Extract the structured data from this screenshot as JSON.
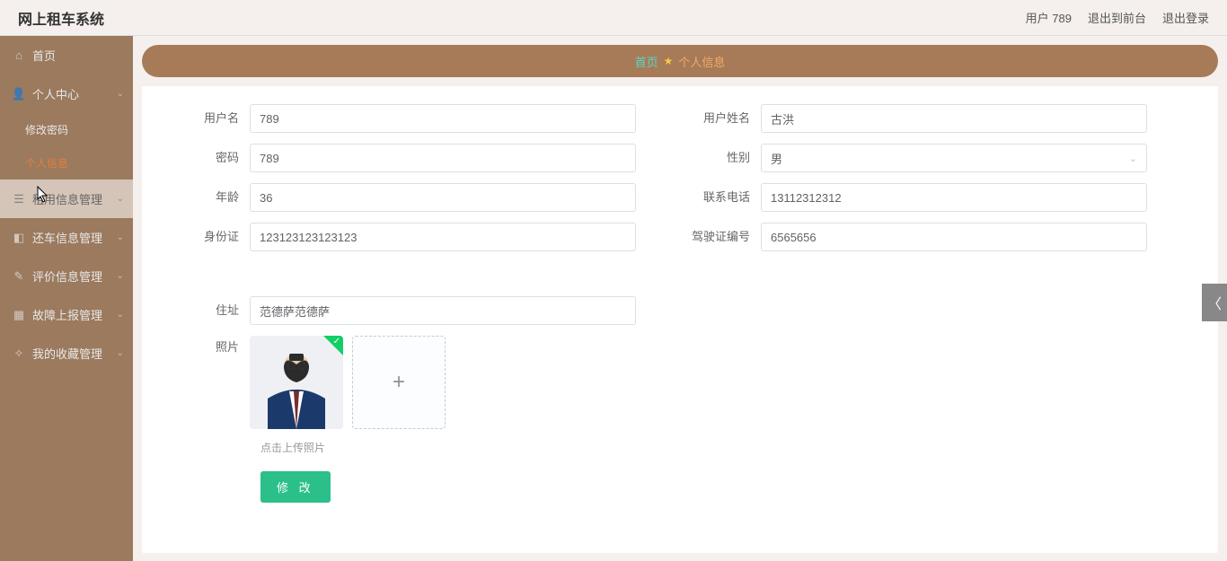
{
  "header": {
    "app_title": "网上租车系统",
    "user_label": "用户 789",
    "exit_front": "退出到前台",
    "logout": "退出登录"
  },
  "sidebar": {
    "home": "首页",
    "personal_center": "个人中心",
    "change_password": "修改密码",
    "personal_info": "个人信息",
    "rent_mgmt": "租用信息管理",
    "return_mgmt": "还车信息管理",
    "review_mgmt": "评价信息管理",
    "fault_mgmt": "故障上报管理",
    "favorite_mgmt": "我的收藏管理"
  },
  "breadcrumb": {
    "home": "首页",
    "current": "个人信息"
  },
  "form": {
    "username_label": "用户名",
    "username_value": "789",
    "realname_label": "用户姓名",
    "realname_value": "古洪",
    "password_label": "密码",
    "password_value": "789",
    "gender_label": "性别",
    "gender_value": "男",
    "age_label": "年龄",
    "age_value": "36",
    "phone_label": "联系电话",
    "phone_value": "13112312312",
    "idcard_label": "身份证",
    "idcard_value": "123123123123123",
    "license_label": "驾驶证编号",
    "license_value": "6565656",
    "address_label": "住址",
    "address_value": "范德萨范德萨",
    "photo_label": "照片",
    "photo_hint": "点击上传照片",
    "submit": "修 改"
  }
}
